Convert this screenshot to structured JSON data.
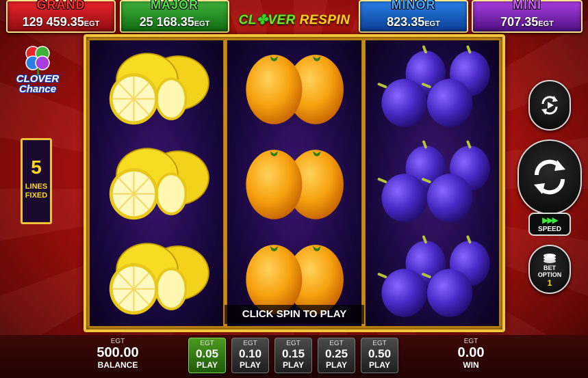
{
  "jackpots": [
    {
      "name": "GRAND",
      "value": "129 459.35",
      "currency": "EGT"
    },
    {
      "name": "MAJOR",
      "value": "25 168.35",
      "currency": "EGT"
    },
    {
      "name": "MINOR",
      "value": "823.35",
      "currency": "EGT"
    },
    {
      "name": "MINI",
      "value": "707.35",
      "currency": "EGT"
    }
  ],
  "game_logo": {
    "word1": "CL",
    "clover_glyph": "✤",
    "word1_end": "VER",
    "word2": "RESPIN"
  },
  "side_logo": {
    "line1": "CLOVER",
    "line2": "Chance"
  },
  "lines": {
    "count": "5",
    "label_line1": "LINES",
    "label_line2": "FIXED"
  },
  "reels": [
    {
      "symbols": [
        "lemon",
        "lemon",
        "lemon"
      ]
    },
    {
      "symbols": [
        "orange",
        "orange",
        "orange"
      ]
    },
    {
      "symbols": [
        "plum",
        "plum",
        "plum"
      ]
    }
  ],
  "message": "CLICK SPIN TO PLAY",
  "controls": {
    "autoplay_icon": "autoplay-icon",
    "spin_icon": "spin-icon",
    "speed_glyph": "▶▶▶",
    "speed_label": "SPEED",
    "bet_option_line1": "BET",
    "bet_option_line2": "OPTION",
    "bet_option_value": "1"
  },
  "balance": {
    "currency": "EGT",
    "value": "500.00",
    "label": "BALANCE"
  },
  "win": {
    "currency": "EGT",
    "value": "0.00",
    "label": "WIN"
  },
  "bets": [
    {
      "currency": "EGT",
      "value": "0.05",
      "label": "PLAY",
      "active": true
    },
    {
      "currency": "EGT",
      "value": "0.10",
      "label": "PLAY",
      "active": false
    },
    {
      "currency": "EGT",
      "value": "0.15",
      "label": "PLAY",
      "active": false
    },
    {
      "currency": "EGT",
      "value": "0.25",
      "label": "PLAY",
      "active": false
    },
    {
      "currency": "EGT",
      "value": "0.50",
      "label": "PLAY",
      "active": false
    }
  ],
  "colors": {
    "grand": "#e8242a",
    "major": "#3fb13a",
    "minor": "#2a7fe6",
    "mini": "#a93ee0",
    "frame_gold": "#f3c53a",
    "active_bet": "#4b9a1f"
  }
}
